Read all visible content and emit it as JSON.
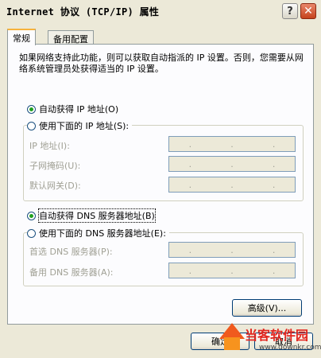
{
  "window": {
    "title": "Internet 协议 (TCP/IP) 属性"
  },
  "titlebar": {
    "help_glyph": "?",
    "close_glyph": "✕"
  },
  "tabs": [
    {
      "label": "常规"
    },
    {
      "label": "备用配置"
    }
  ],
  "description": "如果网络支持此功能，则可以获取自动指派的 IP 设置。否则，您需要从网络系统管理员处获得适当的 IP 设置。",
  "ip": {
    "auto_label": "自动获得 IP 地址(O)",
    "manual_label": "使用下面的 IP 地址(S):",
    "selected": "auto",
    "fields": [
      {
        "label": "IP 地址(I):"
      },
      {
        "label": "子网掩码(U):"
      },
      {
        "label": "默认网关(D):"
      }
    ]
  },
  "dns": {
    "auto_label": "自动获得 DNS 服务器地址(B)",
    "manual_label": "使用下面的 DNS 服务器地址(E):",
    "selected": "auto",
    "fields": [
      {
        "label": "首选 DNS 服务器(P):"
      },
      {
        "label": "备用 DNS 服务器(A):"
      }
    ]
  },
  "ip_dots": ".",
  "buttons": {
    "advanced": "高级(V)...",
    "ok": "确定",
    "cancel": "取消"
  },
  "watermark": {
    "title": "当客软件园",
    "url": "www.downkr.com"
  }
}
